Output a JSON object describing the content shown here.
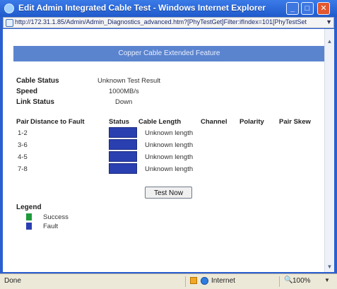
{
  "window": {
    "title": "Edit Admin Integrated Cable Test - Windows Internet Explorer",
    "minimize": "_",
    "maximize": "□",
    "close": "✕"
  },
  "address": {
    "url": "http://172.31.1.85/Admin/Admin_Diagnostics_advanced.htm?[PhyTestGet]Filter:ifIndex=101[PhyTestSet"
  },
  "page": {
    "banner": "Copper Cable Extended Feature",
    "cable_status_label": "Cable Status",
    "cable_status_value": "Unknown Test Result",
    "speed_label": "Speed",
    "speed_value": "1000MB/s",
    "link_status_label": "Link Status",
    "link_status_value": "Down"
  },
  "table": {
    "headers": [
      "Pair",
      "Distance to Fault",
      "Status",
      "Cable Length",
      "Channel",
      "Polarity",
      "Pair Skew"
    ],
    "rows": [
      {
        "pair": "1-2",
        "length": "Unknown length"
      },
      {
        "pair": "3-6",
        "length": "Unknown length"
      },
      {
        "pair": "4-5",
        "length": "Unknown length"
      },
      {
        "pair": "7-8",
        "length": "Unknown length"
      }
    ]
  },
  "test_button": "Test Now",
  "legend": {
    "title": "Legend",
    "items": [
      {
        "label": "Success",
        "color": "#1f9a3b"
      },
      {
        "label": "Fault",
        "color": "#2a3fb0"
      }
    ]
  },
  "statusbar": {
    "status": "Done",
    "zone": "Internet",
    "zoom": "100%"
  }
}
